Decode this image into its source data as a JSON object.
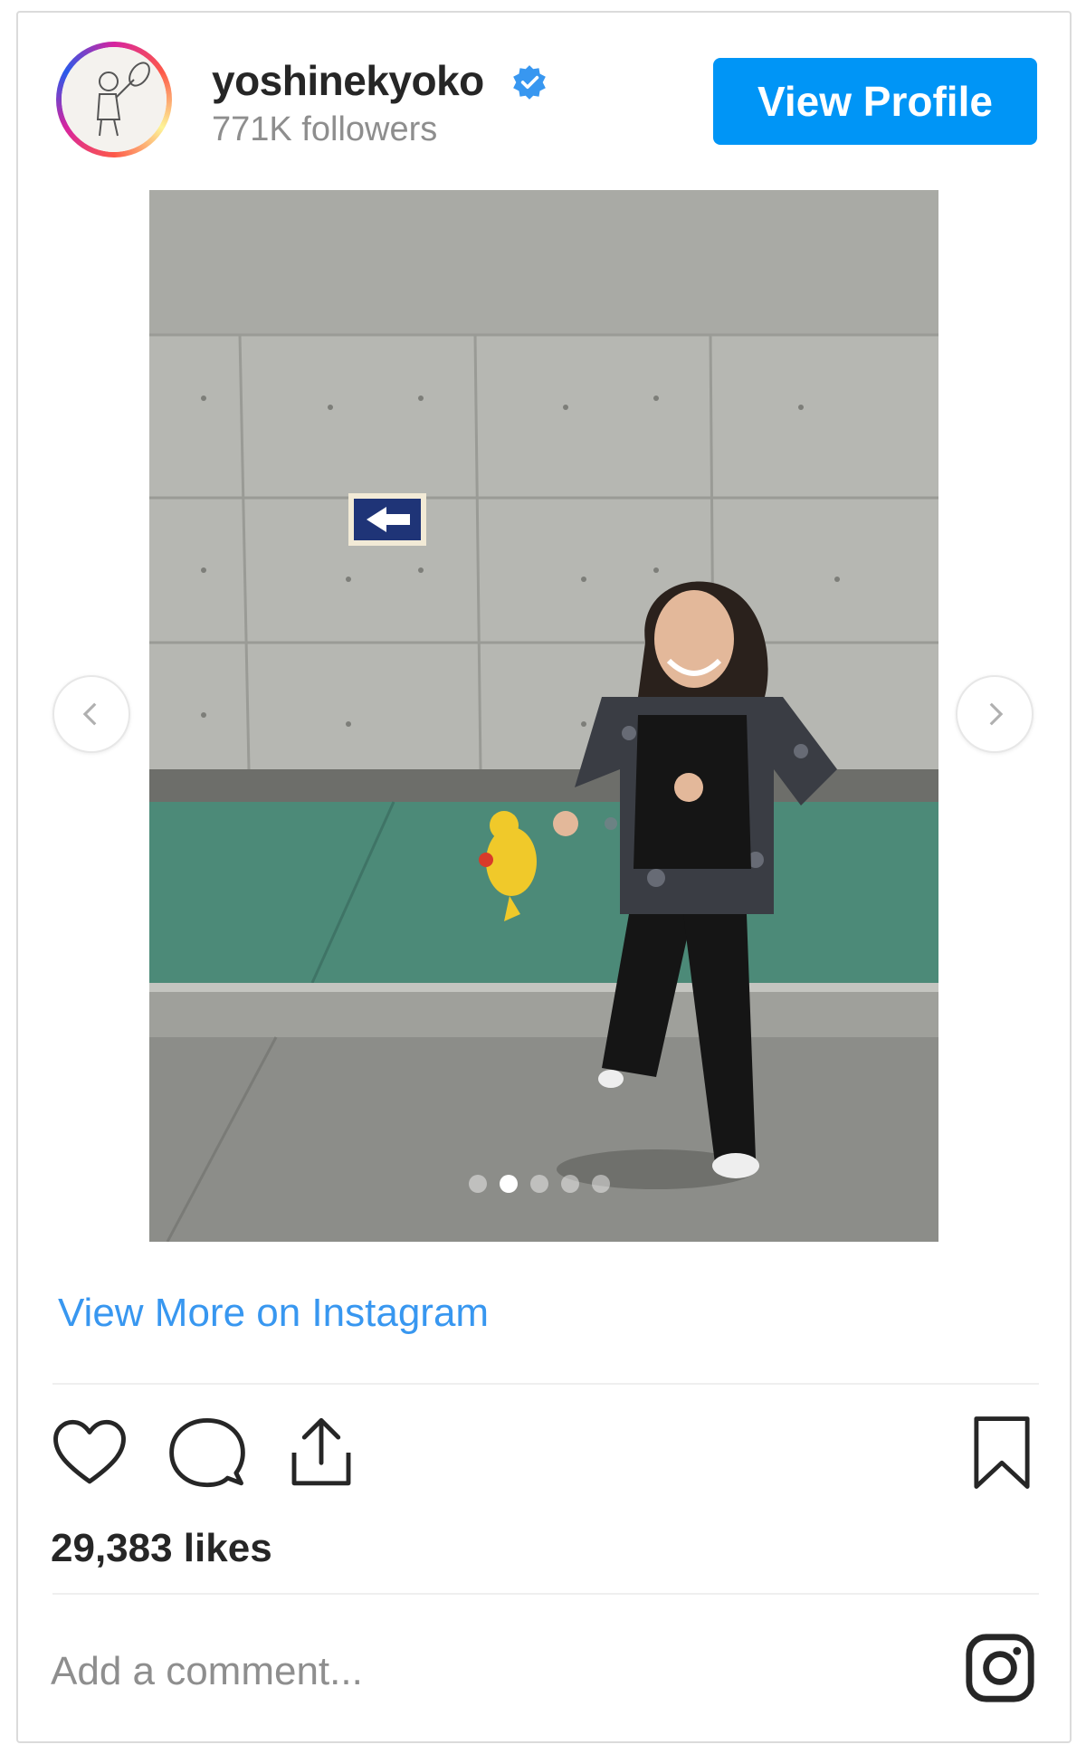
{
  "header": {
    "username": "yoshinekyoko",
    "followers": "771K followers",
    "view_profile_label": "View Profile",
    "verified": true
  },
  "carousel": {
    "slide_count": 5,
    "active_index": 1
  },
  "links": {
    "view_more": "View More on Instagram"
  },
  "actions": {
    "icons": [
      "heart-icon",
      "comment-icon",
      "share-icon",
      "bookmark-icon"
    ]
  },
  "likes": "29,383 likes",
  "comment": {
    "placeholder": "Add a comment..."
  },
  "colors": {
    "accent": "#0095f6",
    "link": "#3897f0",
    "text": "#262626",
    "muted": "#8e8e8e"
  }
}
